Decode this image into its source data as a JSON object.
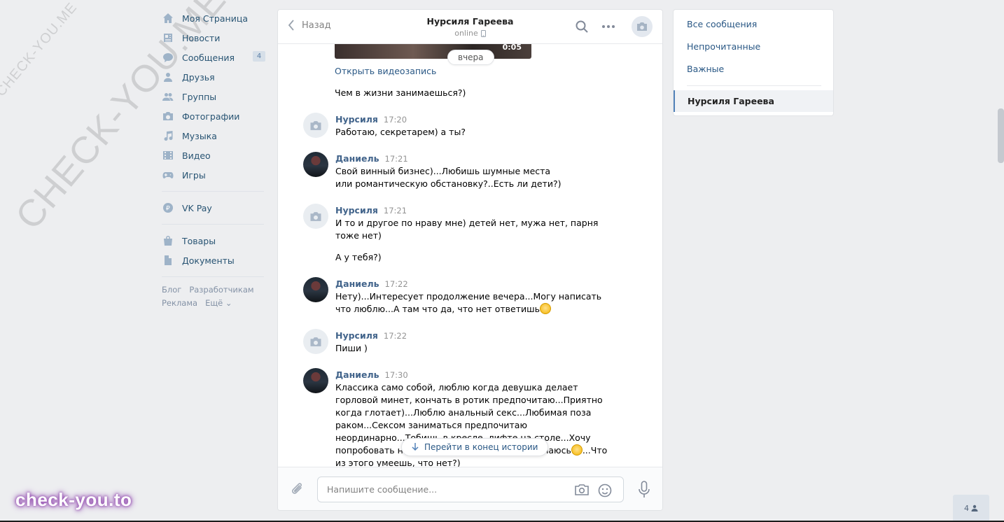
{
  "watermarks": {
    "diagonal": "CHECK-YOU.ME",
    "badge": "check-you.to"
  },
  "nav": {
    "items": [
      {
        "label": "Моя Страница",
        "icon": "home-icon"
      },
      {
        "label": "Новости",
        "icon": "news-icon"
      },
      {
        "label": "Сообщения",
        "icon": "messages-icon",
        "count": "4"
      },
      {
        "label": "Друзья",
        "icon": "friends-icon"
      },
      {
        "label": "Группы",
        "icon": "groups-icon"
      },
      {
        "label": "Фотографии",
        "icon": "camera-icon"
      },
      {
        "label": "Музыка",
        "icon": "music-icon"
      },
      {
        "label": "Видео",
        "icon": "video-icon"
      },
      {
        "label": "Игры",
        "icon": "gamepad-icon"
      }
    ],
    "vkpay": {
      "label": "VK Pay",
      "icon": "vkpay-icon"
    },
    "extra": [
      {
        "label": "Товары",
        "icon": "bag-icon"
      },
      {
        "label": "Документы",
        "icon": "document-icon"
      }
    ],
    "footer": {
      "blog": "Блог",
      "dev": "Разработчикам",
      "ads": "Реклама",
      "more": "Ещё ⌄"
    }
  },
  "chat": {
    "back_label": "Назад",
    "peer_name": "Нурсиля Гареева",
    "peer_status": "online",
    "video_duration": "0:05",
    "day_label": "вчера",
    "open_video": "Открыть видеозапись",
    "top_text": "Чем в жизни занимаешься?)",
    "messages": [
      {
        "author": "Нурсиля",
        "time": "17:20",
        "avatar": "camera-placeholder",
        "lines": [
          "Работаю, секретарем) а ты?"
        ]
      },
      {
        "author": "Даниель",
        "time": "17:21",
        "avatar": "photo",
        "lines": [
          "Свой винный бизнес)...Любишь шумные места или романтическую обстановку?..Есть ли дети?)"
        ]
      },
      {
        "author": "Нурсиля",
        "time": "17:21",
        "avatar": "camera-placeholder",
        "lines": [
          "И то и другое по нраву мне) детей нет, мужа нет, парня тоже нет)",
          "А у тебя?)"
        ]
      },
      {
        "author": "Даниель",
        "time": "17:22",
        "avatar": "photo",
        "lines": [
          "Нету)...Интересует продолжение вечера...Могу написать что люблю...А там что да, что нет ответишь"
        ]
      },
      {
        "author": "Нурсиля",
        "time": "17:22",
        "avatar": "camera-placeholder",
        "lines": [
          "Пиши )"
        ]
      },
      {
        "author": "Даниель",
        "time": "17:30",
        "avatar": "photo",
        "lines": [
          "Классика само собой, люблю когда девушка делает горловой минет, кончать в ротик предпочитаю...Приятно когда глотает)...Люблю анальный секс...Любимая поза раком...Сексом заниматься предпочитаю неординарно...Тобишь в кресле, лифте,на столе...Хочу попробовать на [...] о на кровати им не занимаюсь",
          "...Что из этого умеешь, что нет?)"
        ]
      }
    ],
    "jump_label": "Перейти в конец истории",
    "composer_placeholder": "Напишите сообщение..."
  },
  "filters": {
    "all": "Все сообщения",
    "unread": "Непрочитанные",
    "important": "Важные",
    "active_chat": "Нурсиля Гареева"
  },
  "friends_online": "4",
  "colors": {
    "link": "#2a5885",
    "author": "#42648b",
    "nav_text": "#285473",
    "bg": "#edeef0"
  }
}
